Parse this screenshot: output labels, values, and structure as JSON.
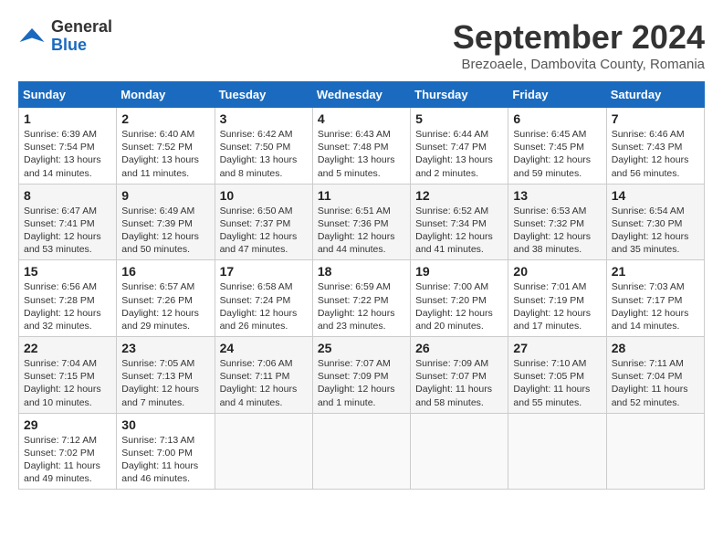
{
  "header": {
    "logo_line1": "General",
    "logo_line2": "Blue",
    "month_title": "September 2024",
    "location": "Brezoaele, Dambovita County, Romania"
  },
  "days_of_week": [
    "Sunday",
    "Monday",
    "Tuesday",
    "Wednesday",
    "Thursday",
    "Friday",
    "Saturday"
  ],
  "weeks": [
    [
      {
        "day": "1",
        "info": "Sunrise: 6:39 AM\nSunset: 7:54 PM\nDaylight: 13 hours and 14 minutes."
      },
      {
        "day": "2",
        "info": "Sunrise: 6:40 AM\nSunset: 7:52 PM\nDaylight: 13 hours and 11 minutes."
      },
      {
        "day": "3",
        "info": "Sunrise: 6:42 AM\nSunset: 7:50 PM\nDaylight: 13 hours and 8 minutes."
      },
      {
        "day": "4",
        "info": "Sunrise: 6:43 AM\nSunset: 7:48 PM\nDaylight: 13 hours and 5 minutes."
      },
      {
        "day": "5",
        "info": "Sunrise: 6:44 AM\nSunset: 7:47 PM\nDaylight: 13 hours and 2 minutes."
      },
      {
        "day": "6",
        "info": "Sunrise: 6:45 AM\nSunset: 7:45 PM\nDaylight: 12 hours and 59 minutes."
      },
      {
        "day": "7",
        "info": "Sunrise: 6:46 AM\nSunset: 7:43 PM\nDaylight: 12 hours and 56 minutes."
      }
    ],
    [
      {
        "day": "8",
        "info": "Sunrise: 6:47 AM\nSunset: 7:41 PM\nDaylight: 12 hours and 53 minutes."
      },
      {
        "day": "9",
        "info": "Sunrise: 6:49 AM\nSunset: 7:39 PM\nDaylight: 12 hours and 50 minutes."
      },
      {
        "day": "10",
        "info": "Sunrise: 6:50 AM\nSunset: 7:37 PM\nDaylight: 12 hours and 47 minutes."
      },
      {
        "day": "11",
        "info": "Sunrise: 6:51 AM\nSunset: 7:36 PM\nDaylight: 12 hours and 44 minutes."
      },
      {
        "day": "12",
        "info": "Sunrise: 6:52 AM\nSunset: 7:34 PM\nDaylight: 12 hours and 41 minutes."
      },
      {
        "day": "13",
        "info": "Sunrise: 6:53 AM\nSunset: 7:32 PM\nDaylight: 12 hours and 38 minutes."
      },
      {
        "day": "14",
        "info": "Sunrise: 6:54 AM\nSunset: 7:30 PM\nDaylight: 12 hours and 35 minutes."
      }
    ],
    [
      {
        "day": "15",
        "info": "Sunrise: 6:56 AM\nSunset: 7:28 PM\nDaylight: 12 hours and 32 minutes."
      },
      {
        "day": "16",
        "info": "Sunrise: 6:57 AM\nSunset: 7:26 PM\nDaylight: 12 hours and 29 minutes."
      },
      {
        "day": "17",
        "info": "Sunrise: 6:58 AM\nSunset: 7:24 PM\nDaylight: 12 hours and 26 minutes."
      },
      {
        "day": "18",
        "info": "Sunrise: 6:59 AM\nSunset: 7:22 PM\nDaylight: 12 hours and 23 minutes."
      },
      {
        "day": "19",
        "info": "Sunrise: 7:00 AM\nSunset: 7:20 PM\nDaylight: 12 hours and 20 minutes."
      },
      {
        "day": "20",
        "info": "Sunrise: 7:01 AM\nSunset: 7:19 PM\nDaylight: 12 hours and 17 minutes."
      },
      {
        "day": "21",
        "info": "Sunrise: 7:03 AM\nSunset: 7:17 PM\nDaylight: 12 hours and 14 minutes."
      }
    ],
    [
      {
        "day": "22",
        "info": "Sunrise: 7:04 AM\nSunset: 7:15 PM\nDaylight: 12 hours and 10 minutes."
      },
      {
        "day": "23",
        "info": "Sunrise: 7:05 AM\nSunset: 7:13 PM\nDaylight: 12 hours and 7 minutes."
      },
      {
        "day": "24",
        "info": "Sunrise: 7:06 AM\nSunset: 7:11 PM\nDaylight: 12 hours and 4 minutes."
      },
      {
        "day": "25",
        "info": "Sunrise: 7:07 AM\nSunset: 7:09 PM\nDaylight: 12 hours and 1 minute."
      },
      {
        "day": "26",
        "info": "Sunrise: 7:09 AM\nSunset: 7:07 PM\nDaylight: 11 hours and 58 minutes."
      },
      {
        "day": "27",
        "info": "Sunrise: 7:10 AM\nSunset: 7:05 PM\nDaylight: 11 hours and 55 minutes."
      },
      {
        "day": "28",
        "info": "Sunrise: 7:11 AM\nSunset: 7:04 PM\nDaylight: 11 hours and 52 minutes."
      }
    ],
    [
      {
        "day": "29",
        "info": "Sunrise: 7:12 AM\nSunset: 7:02 PM\nDaylight: 11 hours and 49 minutes."
      },
      {
        "day": "30",
        "info": "Sunrise: 7:13 AM\nSunset: 7:00 PM\nDaylight: 11 hours and 46 minutes."
      },
      {
        "day": "",
        "info": ""
      },
      {
        "day": "",
        "info": ""
      },
      {
        "day": "",
        "info": ""
      },
      {
        "day": "",
        "info": ""
      },
      {
        "day": "",
        "info": ""
      }
    ]
  ]
}
